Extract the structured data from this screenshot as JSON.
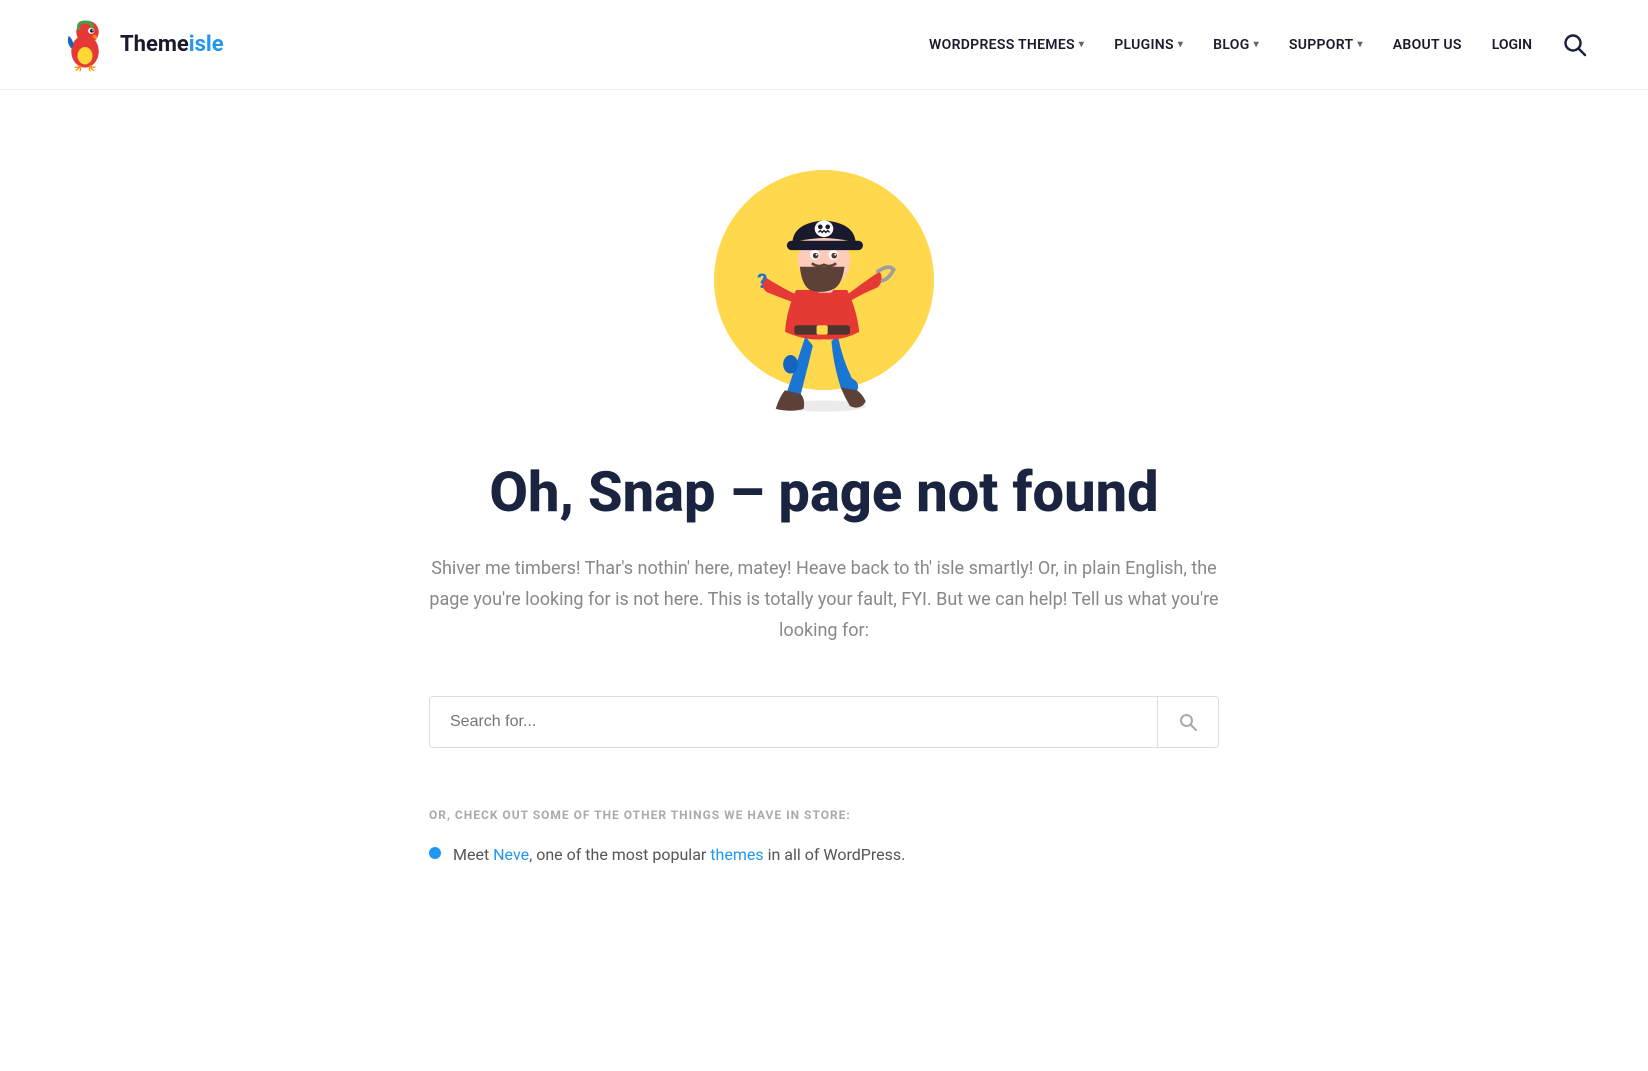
{
  "header": {
    "logo_text_main": "Theme",
    "logo_text_accent": "isle",
    "nav": [
      {
        "label": "WORDPRESS THEMES",
        "has_dropdown": true
      },
      {
        "label": "PLUGINS",
        "has_dropdown": true
      },
      {
        "label": "BLOG",
        "has_dropdown": true
      },
      {
        "label": "SUPPORT",
        "has_dropdown": true
      },
      {
        "label": "ABOUT US",
        "has_dropdown": false
      },
      {
        "label": "LOGIN",
        "has_dropdown": false
      }
    ]
  },
  "main": {
    "heading": "Oh, Snap – page not found",
    "subtitle": "Shiver me timbers! Thar's nothin' here, matey! Heave back to th' isle smartly! Or, in plain English, the page you're looking for is not here. This is totally your fault, FYI. But we can help! Tell us what you're looking for:",
    "search_placeholder": "Search for...",
    "check_out_label": "OR, CHECK OUT SOME OF THE OTHER THINGS WE HAVE IN STORE:",
    "bullet_text_before": "Meet ",
    "bullet_link1": "Neve",
    "bullet_text_middle": ", one of the most popular ",
    "bullet_link2": "themes",
    "bullet_text_after": " in all of WordPress."
  },
  "colors": {
    "accent": "#2196F3",
    "heading": "#1a2340",
    "yellow": "#FFD84D"
  }
}
